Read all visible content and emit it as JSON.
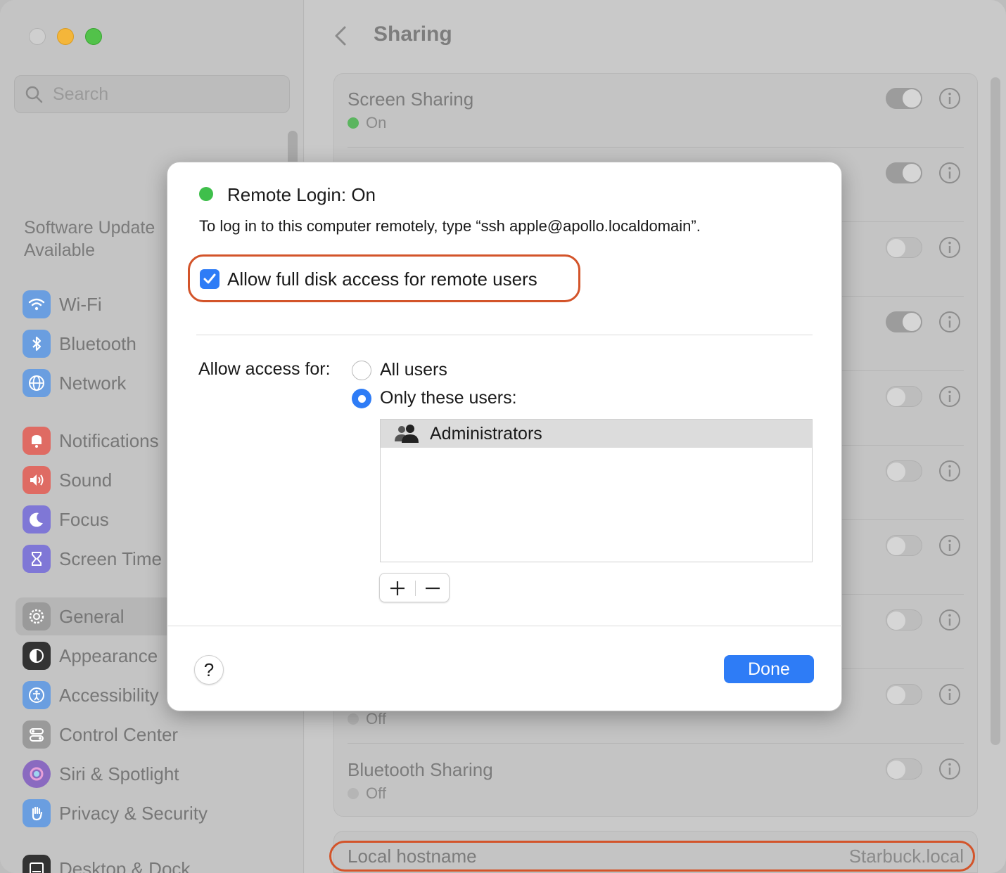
{
  "sidebar": {
    "search_placeholder": "Search",
    "update_notice": "Software Update Available",
    "items": [
      {
        "label": "Wi-Fi",
        "icon": "wifi-icon",
        "color": "#6a9ee0"
      },
      {
        "label": "Bluetooth",
        "icon": "bluetooth-icon",
        "color": "#6a9ee0"
      },
      {
        "label": "Network",
        "icon": "globe-icon",
        "color": "#6a9ee0"
      },
      {
        "label": "Notifications",
        "icon": "bell-icon",
        "color": "#df6b63"
      },
      {
        "label": "Sound",
        "icon": "speaker-icon",
        "color": "#df6b63"
      },
      {
        "label": "Focus",
        "icon": "moon-icon",
        "color": "#7f77d6"
      },
      {
        "label": "Screen Time",
        "icon": "hourglass-icon",
        "color": "#7f77d6"
      },
      {
        "label": "General",
        "icon": "gear-icon",
        "color": "#9a9a9a"
      },
      {
        "label": "Appearance",
        "icon": "appearance-icon",
        "color": "#333333"
      },
      {
        "label": "Accessibility",
        "icon": "accessibility-icon",
        "color": "#6a9ee0"
      },
      {
        "label": "Control Center",
        "icon": "switches-icon",
        "color": "#9a9a9a"
      },
      {
        "label": "Siri & Spotlight",
        "icon": "siri-icon",
        "color": "#8a6ac0"
      },
      {
        "label": "Privacy & Security",
        "icon": "hand-icon",
        "color": "#6a9ee0"
      },
      {
        "label": "Desktop & Dock",
        "icon": "dock-icon",
        "color": "#333333"
      }
    ]
  },
  "header": {
    "title": "Sharing"
  },
  "services": [
    {
      "title": "Screen Sharing",
      "status": "On",
      "toggle": "on"
    },
    {
      "title": "",
      "status": "",
      "toggle": "on"
    },
    {
      "title": "",
      "status": "",
      "toggle": "off"
    },
    {
      "title": "",
      "status": "",
      "toggle": "on"
    },
    {
      "title": "",
      "status": "",
      "toggle": "off"
    },
    {
      "title": "",
      "status": "",
      "toggle": "off"
    },
    {
      "title": "",
      "status": "",
      "toggle": "off"
    },
    {
      "title": "",
      "status": "",
      "toggle": "off"
    },
    {
      "title": "",
      "status": "Off",
      "toggle": "off"
    },
    {
      "title": "Bluetooth Sharing",
      "status": "Off",
      "toggle": "off"
    }
  ],
  "hostname": {
    "label": "Local hostname",
    "value": "Starbuck.local"
  },
  "modal": {
    "title": "Remote Login: On",
    "description": "To log in to this computer remotely, type “ssh apple@apollo.localdomain”.",
    "full_disk_access_label": "Allow full disk access for remote users",
    "full_disk_access_checked": true,
    "allow_access_label": "Allow access for:",
    "option_all": "All users",
    "option_only": "Only these users:",
    "selected_option": "only",
    "users": [
      "Administrators"
    ],
    "add_symbol": "+",
    "remove_symbol": "−",
    "help_symbol": "?",
    "done_label": "Done"
  },
  "colors": {
    "accent": "#2e7cf6",
    "status_on": "#3fbf4b",
    "highlight": "#d3542a"
  }
}
